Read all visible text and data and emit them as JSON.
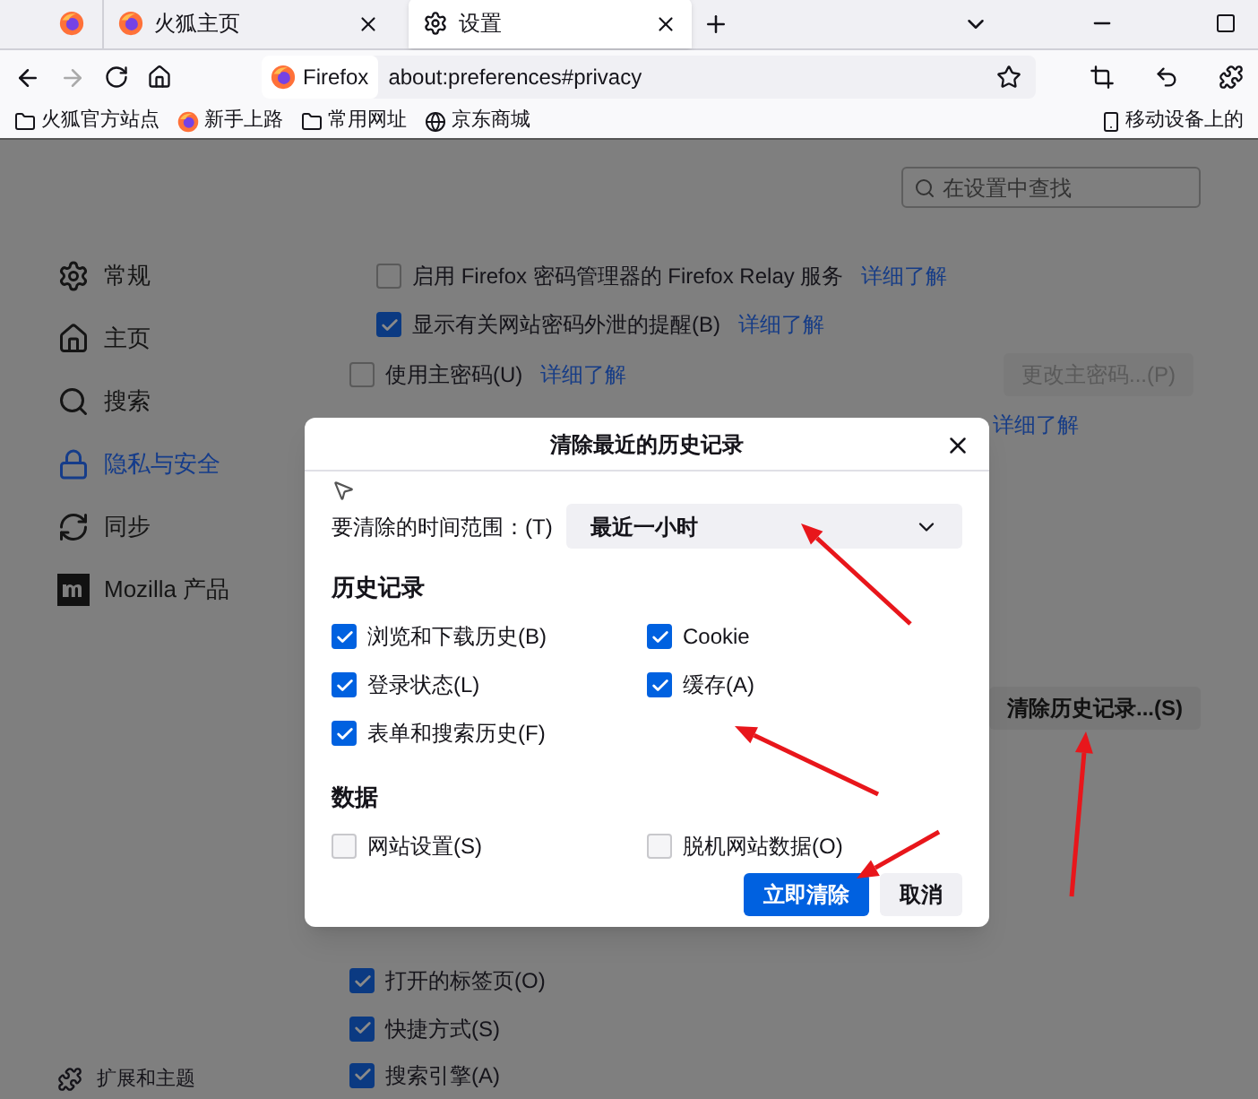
{
  "tabs": [
    {
      "kind": "pinned",
      "selected": false
    },
    {
      "kind": "page",
      "label": "火狐主页",
      "selected": false
    },
    {
      "kind": "settings",
      "label": "设置",
      "selected": true
    }
  ],
  "address_bar": {
    "identity": "Firefox",
    "url": "about:preferences#privacy"
  },
  "bookmarks": [
    {
      "kind": "folder",
      "label": "火狐官方站点"
    },
    {
      "kind": "firefox",
      "label": "新手上路"
    },
    {
      "kind": "folder",
      "label": "常用网址"
    },
    {
      "kind": "globe",
      "label": "京东商城"
    }
  ],
  "mobile_bookmarks": "移动设备上的",
  "search": {
    "placeholder": "在设置中查找"
  },
  "sidebar": {
    "items": [
      {
        "kind": "gear",
        "label": "常规",
        "selected": false
      },
      {
        "kind": "home",
        "label": "主页",
        "selected": false
      },
      {
        "kind": "search",
        "label": "搜索",
        "selected": false
      },
      {
        "kind": "lock",
        "label": "隐私与安全",
        "selected": true
      },
      {
        "kind": "sync",
        "label": "同步",
        "selected": false
      },
      {
        "kind": "mozilla",
        "label": "Mozilla 产品",
        "selected": false
      }
    ],
    "footer": "扩展和主题"
  },
  "settings": {
    "rows": [
      {
        "label": "启用 Firefox 密码管理器的 Firefox Relay 服务",
        "checked": false,
        "indent": true,
        "link": "详细了解"
      },
      {
        "label": "显示有关网站密码外泄的提醒(B)",
        "checked": true,
        "indent": true,
        "link": "详细了解"
      },
      {
        "label": "使用主密码(U)",
        "checked": false,
        "indent": false,
        "link": "详细了解",
        "button": "更改主密码...(P)"
      }
    ],
    "hidden_row_link": "详细了解",
    "clear_button": "清除历史记录...(S)",
    "lower_rows": [
      {
        "label": "打开的标签页(O)",
        "checked": true
      },
      {
        "label": "快捷方式(S)",
        "checked": true
      },
      {
        "label": "搜索引擎(A)",
        "checked": true
      }
    ]
  },
  "dialog": {
    "title": "清除最近的历史记录",
    "range_label": "要清除的时间范围：(T)",
    "range_value": "最近一小时",
    "sections": [
      {
        "heading": "历史记录",
        "items": [
          {
            "label": "浏览和下载历史(B)",
            "checked": true
          },
          {
            "label": "Cookie",
            "checked": true
          },
          {
            "label": "登录状态(L)",
            "checked": true
          },
          {
            "label": "缓存(A)",
            "checked": true
          },
          {
            "label": "表单和搜索历史(F)",
            "checked": true
          }
        ]
      },
      {
        "heading": "数据",
        "items": [
          {
            "label": "网站设置(S)",
            "checked": false
          },
          {
            "label": "脱机网站数据(O)",
            "checked": false
          }
        ]
      }
    ],
    "buttons": [
      {
        "kind": "primary",
        "label": "立即清除"
      },
      {
        "kind": "secondary",
        "label": "取消"
      }
    ]
  }
}
